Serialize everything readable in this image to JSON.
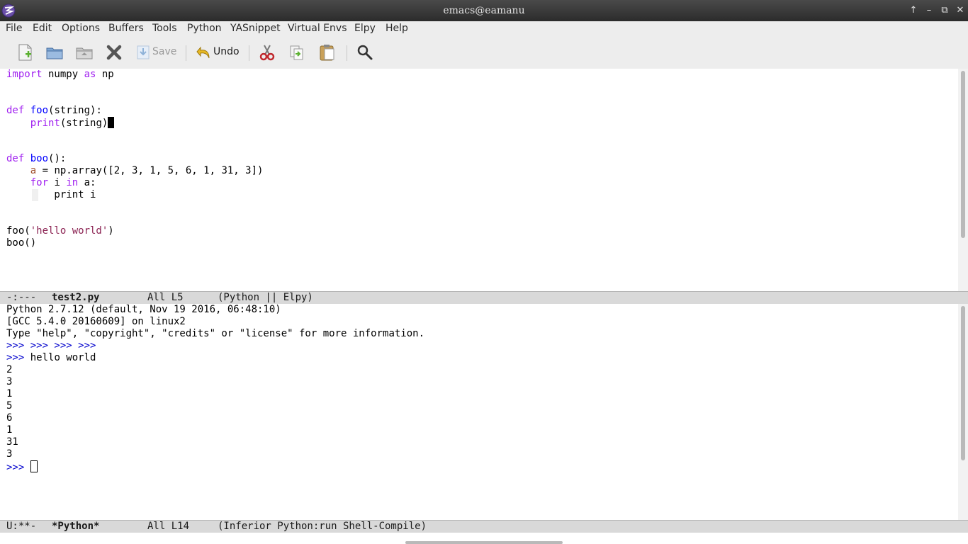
{
  "window": {
    "title": "emacs@eamanu"
  },
  "menubar": [
    "File",
    "Edit",
    "Options",
    "Buffers",
    "Tools",
    "Python",
    "YASnippet",
    "Virtual Envs",
    "Elpy",
    "Help"
  ],
  "toolbar": {
    "save_label": "Save",
    "undo_label": "Undo"
  },
  "editor": {
    "lines": {
      "l1": {
        "a": "import",
        "b": " numpy ",
        "c": "as",
        "d": " np"
      },
      "l4": {
        "a": "def ",
        "b": "foo",
        "c": "(string):"
      },
      "l5": {
        "a": "    ",
        "b": "print",
        "c": "(string)"
      },
      "l8": {
        "a": "def ",
        "b": "boo",
        "c": "():"
      },
      "l9": {
        "a": "    ",
        "b": "a",
        "c": " = np.array([2, 3, 1, 5, 6, 1, 31, 3])"
      },
      "l10": {
        "a": "    ",
        "b": "for",
        "c": " i ",
        "d": "in",
        "e": " a:"
      },
      "l11": {
        "a": "        print i"
      },
      "l14": {
        "a": "foo(",
        "b": "'hello world'",
        "c": ")"
      },
      "l15": {
        "a": "boo()"
      }
    }
  },
  "modeline_top": {
    "status": "-:---",
    "buffer": "test2.py",
    "position": "All L5",
    "mode": "(Python || Elpy)"
  },
  "shell": {
    "banner1": "Python 2.7.12 (default, Nov 19 2016, 06:48:10)",
    "banner2": "[GCC 5.4.0 20160609] on linux2",
    "banner3": "Type \"help\", \"copyright\", \"credits\" or \"license\" for more information.",
    "prompts": ">>> >>> >>> >>>",
    "prompt": ">>>",
    "hello": " hello world",
    "outputs": [
      "2",
      "3",
      "1",
      "5",
      "6",
      "1",
      "31",
      "3"
    ]
  },
  "modeline_bottom": {
    "status": "U:**-",
    "buffer": "*Python*",
    "position": "All L14",
    "mode": "(Inferior Python:run Shell-Compile)"
  }
}
